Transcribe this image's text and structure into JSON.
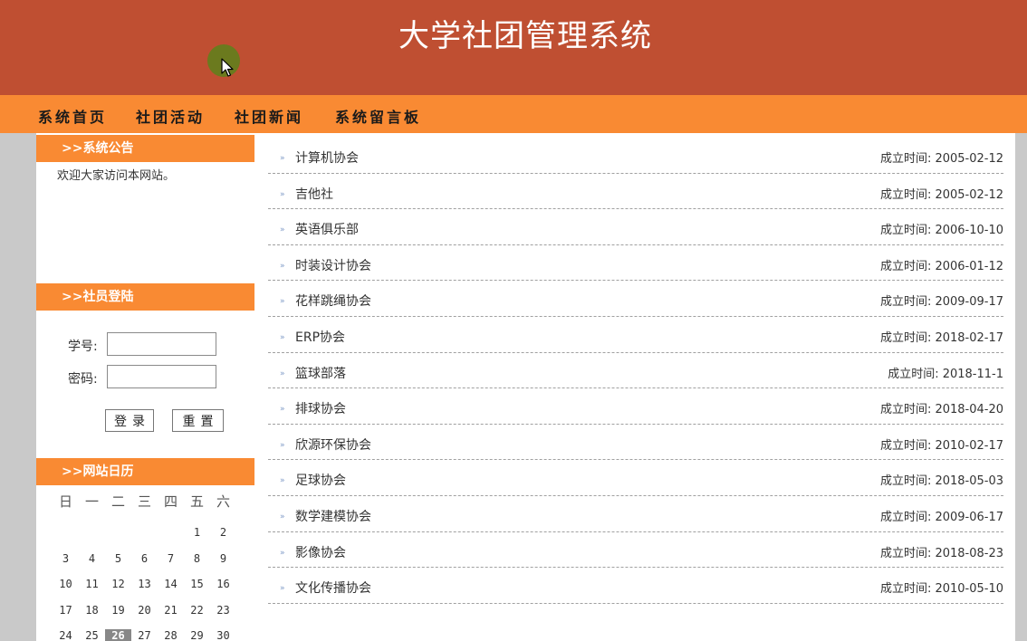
{
  "header": {
    "title": "大学社团管理系统"
  },
  "nav": [
    {
      "label": "系统首页"
    },
    {
      "label": "社团活动"
    },
    {
      "label": "社团新闻"
    },
    {
      "label": "系统留言板"
    }
  ],
  "sidebar": {
    "notice": {
      "title": ">>系统公告",
      "text": "欢迎大家访问本网站。"
    },
    "login": {
      "title": ">>社员登陆",
      "id_label": "学号:",
      "id_value": "",
      "pwd_label": "密码:",
      "pwd_value": "",
      "login_btn": "登录",
      "reset_btn": "重置"
    },
    "calendar": {
      "title": ">>网站日历",
      "weekdays": [
        "日",
        "一",
        "二",
        "三",
        "四",
        "五",
        "六"
      ],
      "weeks": [
        [
          "",
          "",
          "",
          "",
          "",
          "1",
          "2"
        ],
        [
          "3",
          "4",
          "5",
          "6",
          "7",
          "8",
          "9"
        ],
        [
          "10",
          "11",
          "12",
          "13",
          "14",
          "15",
          "16"
        ],
        [
          "17",
          "18",
          "19",
          "20",
          "21",
          "22",
          "23"
        ],
        [
          "24",
          "25",
          "26",
          "27",
          "28",
          "29",
          "30"
        ]
      ],
      "today": "26"
    }
  },
  "clubs": [
    {
      "name": "计算机协会",
      "date": "成立时间: 2005-02-12"
    },
    {
      "name": "吉他社",
      "date": "成立时间: 2005-02-12"
    },
    {
      "name": "英语俱乐部",
      "date": "成立时间: 2006-10-10"
    },
    {
      "name": "时装设计协会",
      "date": "成立时间: 2006-01-12"
    },
    {
      "name": "花样跳绳协会",
      "date": "成立时间: 2009-09-17"
    },
    {
      "name": "ERP协会",
      "date": "成立时间: 2018-02-17"
    },
    {
      "name": "篮球部落",
      "date": "成立时间: 2018-11-1"
    },
    {
      "name": "排球协会",
      "date": "成立时间: 2018-04-20"
    },
    {
      "name": "欣源环保协会",
      "date": "成立时间: 2010-02-17"
    },
    {
      "name": "足球协会",
      "date": "成立时间: 2018-05-03"
    },
    {
      "name": "数学建模协会",
      "date": "成立时间: 2009-06-17"
    },
    {
      "name": "影像协会",
      "date": "成立时间: 2018-08-23"
    },
    {
      "name": "文化传播协会",
      "date": "成立时间: 2010-05-10"
    }
  ],
  "colors": {
    "header_bg": "#bf4f32",
    "nav_bg": "#f98a33",
    "box_header_bg": "#f98a33"
  }
}
